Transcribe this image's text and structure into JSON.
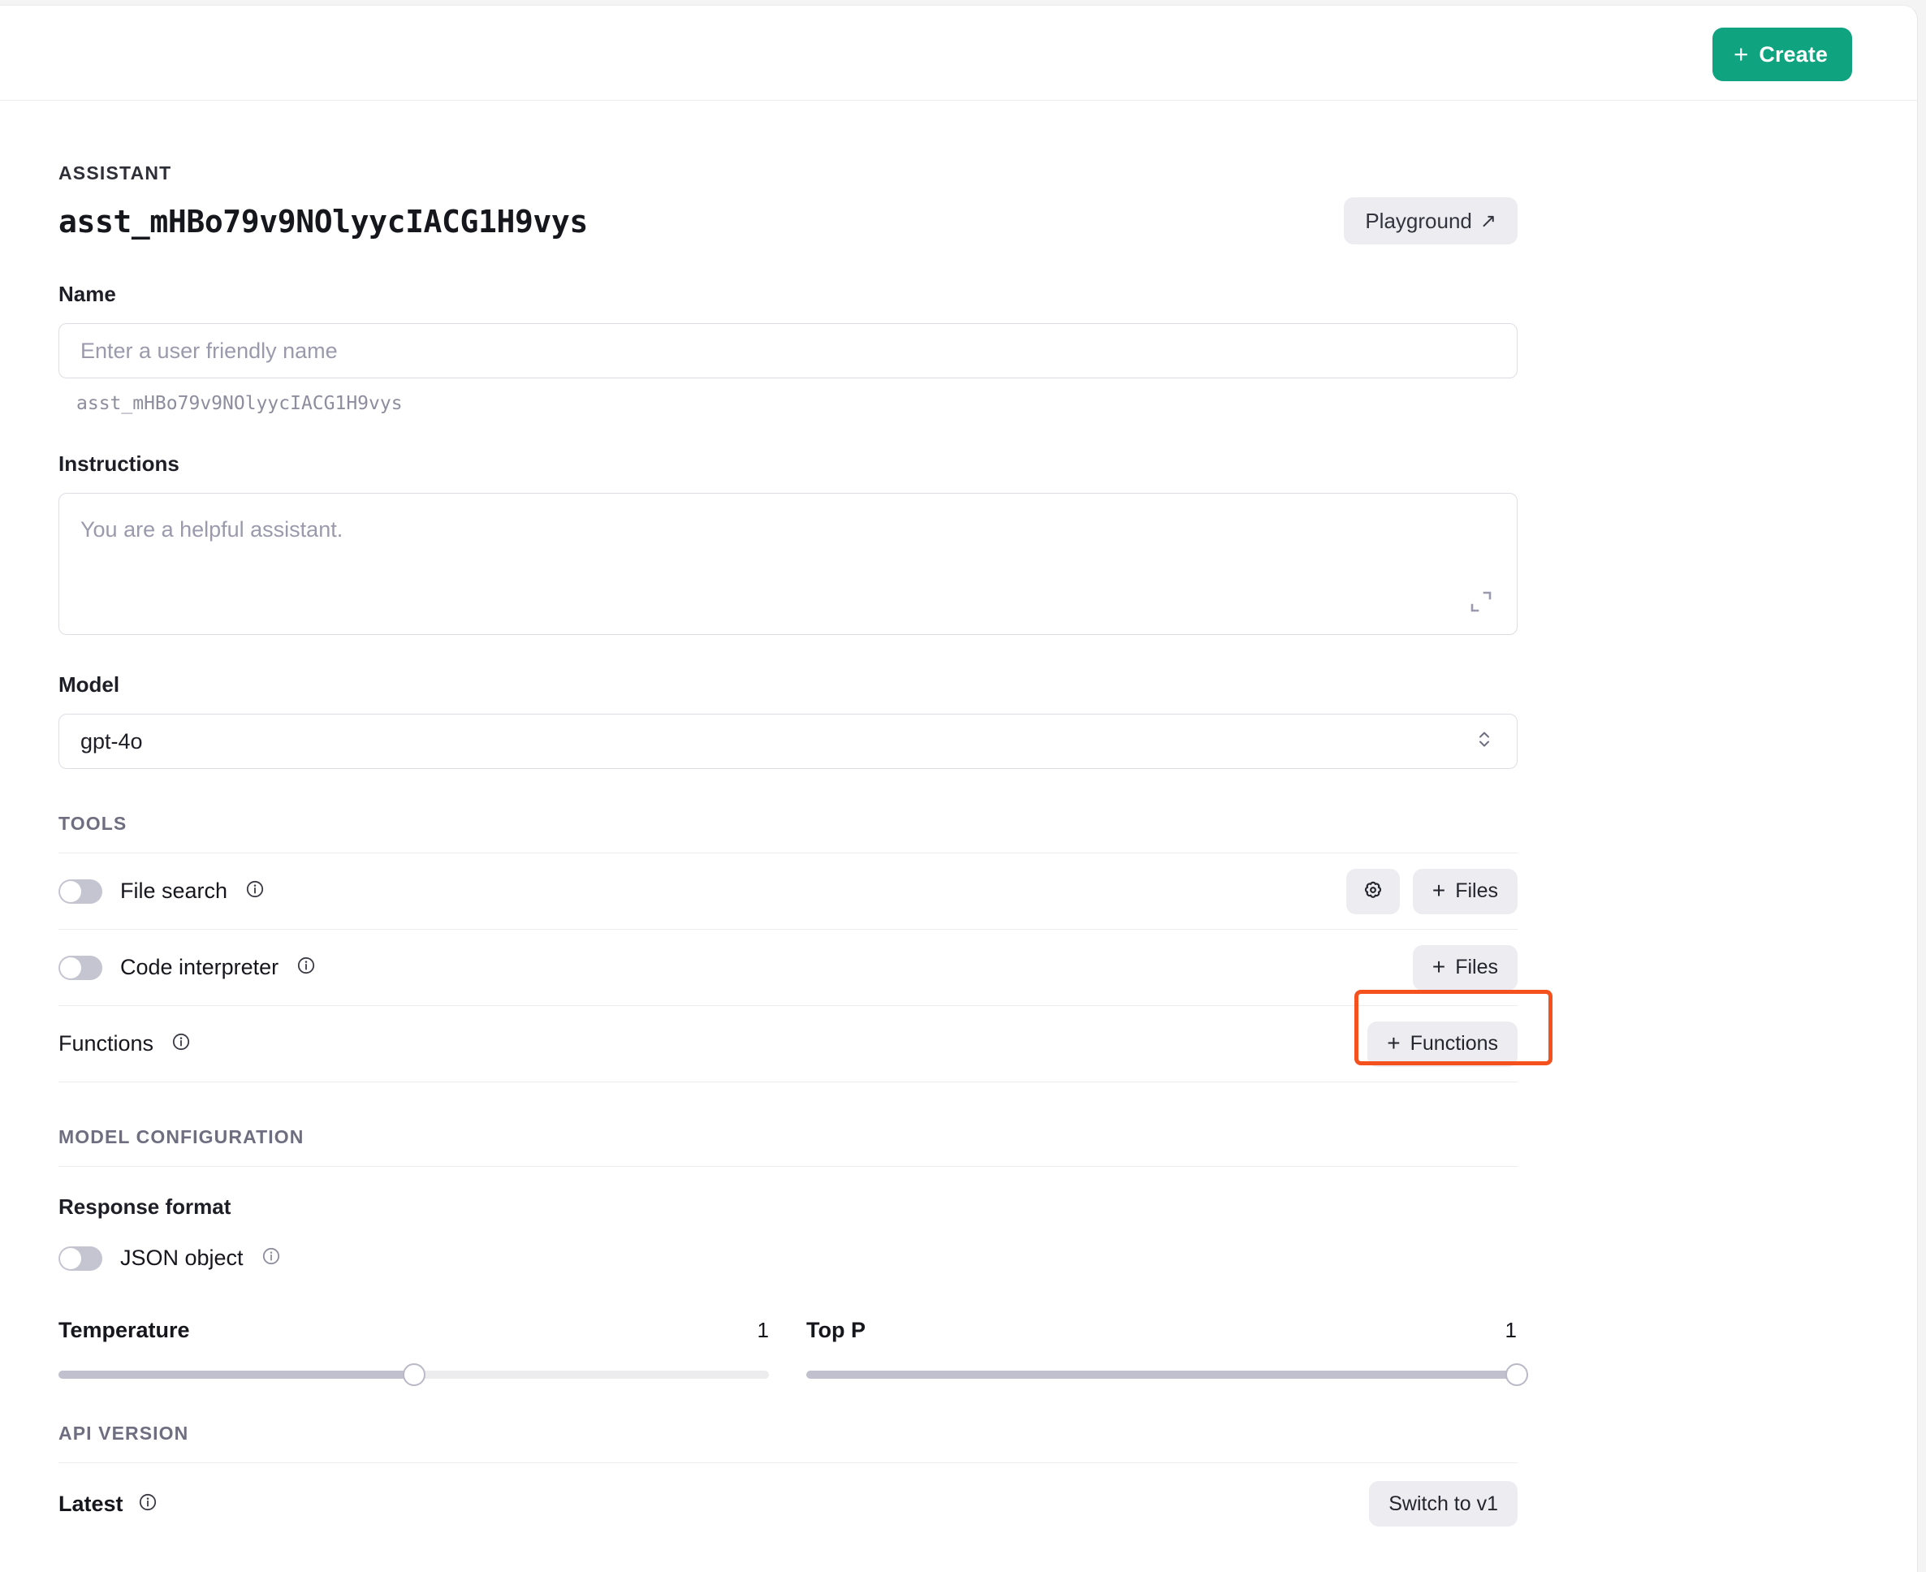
{
  "topbar": {
    "create_label": "Create",
    "create_plus": "+",
    "create_color": "#10a37f"
  },
  "header": {
    "eyebrow": "ASSISTANT",
    "assistant_id": "asst_mHBo79v9NOlyycIACG1H9vys",
    "playground_label": "Playground",
    "playground_arrow": "↗"
  },
  "name_field": {
    "label": "Name",
    "value": "",
    "placeholder": "Enter a user friendly name",
    "helper_id": "asst_mHBo79v9NOlyycIACG1H9vys"
  },
  "instructions_field": {
    "label": "Instructions",
    "value": "",
    "placeholder": "You are a helpful assistant.",
    "resize_icon": "expand-icon"
  },
  "model_field": {
    "label": "Model",
    "value": "gpt-4o",
    "options": [
      "gpt-4o"
    ],
    "chevron_icon": "chevron-updown-icon"
  },
  "tools": {
    "section_title": "TOOLS",
    "rows": [
      {
        "label": "File search",
        "toggle_on": false,
        "info_icon": "info-icon",
        "settings_icon": "gear-icon",
        "has_settings": true,
        "action_label": "Files",
        "action_plus": "+"
      },
      {
        "label": "Code interpreter",
        "toggle_on": false,
        "info_icon": "info-icon",
        "has_settings": false,
        "action_label": "Files",
        "action_plus": "+"
      },
      {
        "label": "Functions",
        "has_toggle": false,
        "info_icon": "info-icon",
        "has_settings": false,
        "action_label": "Functions",
        "action_plus": "+",
        "highlighted": true,
        "highlight_color": "#f4511e"
      }
    ]
  },
  "model_configuration": {
    "section_title": "MODEL CONFIGURATION",
    "response_format_label": "Response format",
    "json_object_label": "JSON object",
    "json_object_toggle_on": false,
    "temperature": {
      "label": "Temperature",
      "value": "1",
      "percent": 50
    },
    "top_p": {
      "label": "Top P",
      "value": "1",
      "percent": 100
    }
  },
  "api_version": {
    "section_title": "API VERSION",
    "current_label": "Latest",
    "info_icon": "info-icon",
    "switch_label": "Switch to v1"
  }
}
